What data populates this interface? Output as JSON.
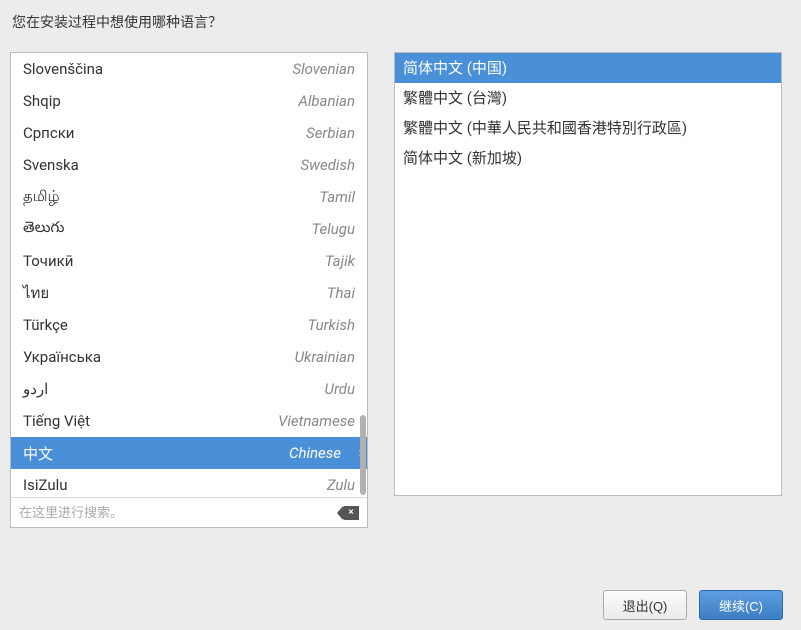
{
  "question": "您在安装过程中想使用哪种语言？",
  "search": {
    "placeholder": "在这里进行搜索。"
  },
  "languages": [
    {
      "native": "Slovenščina",
      "english": "Slovenian",
      "selected": false
    },
    {
      "native": "Shqip",
      "english": "Albanian",
      "selected": false
    },
    {
      "native": "Српски",
      "english": "Serbian",
      "selected": false
    },
    {
      "native": "Svenska",
      "english": "Swedish",
      "selected": false
    },
    {
      "native": "தமிழ்",
      "english": "Tamil",
      "selected": false
    },
    {
      "native": "తెలుగు",
      "english": "Telugu",
      "selected": false
    },
    {
      "native": "Точикӣ",
      "english": "Tajik",
      "selected": false
    },
    {
      "native": "ไทย",
      "english": "Thai",
      "selected": false
    },
    {
      "native": "Türkçe",
      "english": "Turkish",
      "selected": false
    },
    {
      "native": "Українська",
      "english": "Ukrainian",
      "selected": false
    },
    {
      "native": "اردو",
      "english": "Urdu",
      "selected": false
    },
    {
      "native": "Tiếng Việt",
      "english": "Vietnamese",
      "selected": false
    },
    {
      "native": "中文",
      "english": "Chinese",
      "selected": true
    },
    {
      "native": "IsiZulu",
      "english": "Zulu",
      "selected": false
    }
  ],
  "locales": [
    {
      "label": "简体中文 (中国)",
      "selected": true
    },
    {
      "label": "繁體中文 (台灣)",
      "selected": false
    },
    {
      "label": "繁體中文 (中華人民共和國香港特別行政區)",
      "selected": false
    },
    {
      "label": "简体中文 (新加坡)",
      "selected": false
    }
  ],
  "buttons": {
    "quit": "退出(Q)",
    "continue": "继续(C)"
  }
}
